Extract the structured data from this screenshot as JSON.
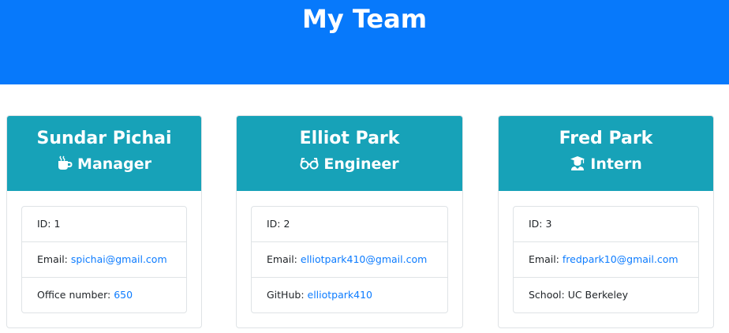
{
  "header": {
    "title": "My Team"
  },
  "colors": {
    "header_bg": "#0779fb",
    "card_header_bg": "#17a2b8",
    "link": "#0d7cff"
  },
  "employees": [
    {
      "name": "Sundar Pichai",
      "role": "Manager",
      "role_icon": "coffee-icon",
      "id_label": "ID:",
      "id": "1",
      "email_label": "Email:",
      "email": "spichai@gmail.com",
      "extra_label": "Office number:",
      "extra_value": "650"
    },
    {
      "name": "Elliot Park",
      "role": "Engineer",
      "role_icon": "glasses-icon",
      "id_label": "ID:",
      "id": "2",
      "email_label": "Email:",
      "email": "elliotpark410@gmail.com",
      "extra_label": "GitHub:",
      "extra_value": "elliotpark410"
    },
    {
      "name": "Fred Park",
      "role": "Intern",
      "role_icon": "graduate-icon",
      "id_label": "ID:",
      "id": "3",
      "email_label": "Email:",
      "email": "fredpark10@gmail.com",
      "extra_label": "School:",
      "extra_value": "UC Berkeley"
    }
  ]
}
